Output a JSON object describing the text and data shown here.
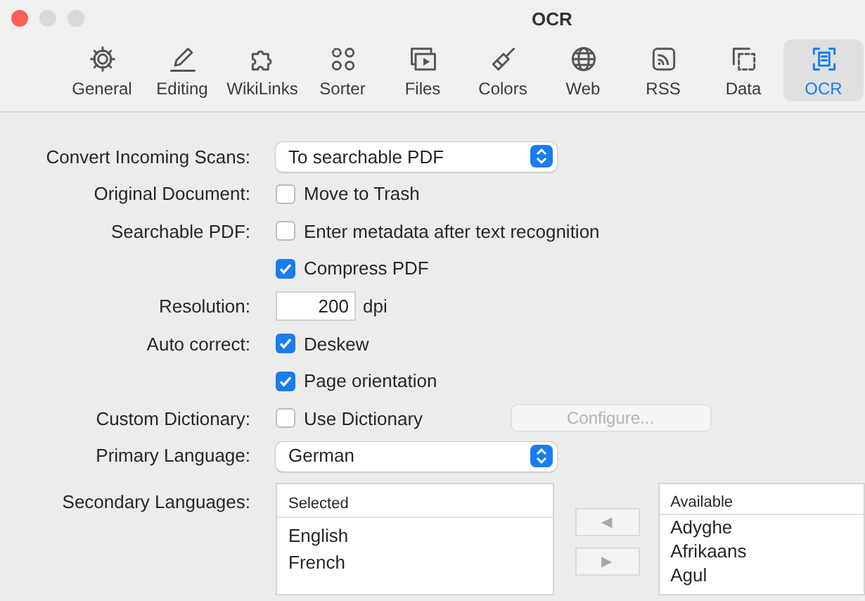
{
  "window": {
    "title": "OCR"
  },
  "toolbar": [
    {
      "label": "General",
      "selected": false
    },
    {
      "label": "Editing",
      "selected": false
    },
    {
      "label": "WikiLinks",
      "selected": false
    },
    {
      "label": "Sorter",
      "selected": false
    },
    {
      "label": "Files",
      "selected": false
    },
    {
      "label": "Colors",
      "selected": false
    },
    {
      "label": "Web",
      "selected": false
    },
    {
      "label": "RSS",
      "selected": false
    },
    {
      "label": "Data",
      "selected": false
    },
    {
      "label": "OCR",
      "selected": true
    }
  ],
  "rows": [
    {
      "label": "Convert Incoming Scans:",
      "controls": [
        {
          "kind": "popup",
          "value": "To searchable PDF"
        }
      ]
    },
    {
      "label": "Original Document:",
      "controls": [
        {
          "kind": "checkbox",
          "label": "Move to Trash",
          "checked": false
        }
      ]
    },
    {
      "label": "Searchable PDF:",
      "controls": [
        {
          "kind": "checkbox",
          "label": "Enter metadata after text recognition",
          "checked": false
        }
      ]
    },
    {
      "controls": [
        {
          "kind": "checkbox",
          "label": "Compress PDF",
          "checked": true
        }
      ]
    },
    {
      "label": "Resolution:",
      "controls": [
        {
          "kind": "number",
          "value": "200",
          "unit": "dpi"
        }
      ]
    },
    {
      "label": "Auto correct:",
      "controls": [
        {
          "kind": "checkbox",
          "label": "Deskew",
          "checked": true
        }
      ]
    },
    {
      "controls": [
        {
          "kind": "checkbox",
          "label": "Page orientation",
          "checked": true
        }
      ]
    },
    {
      "label": "Custom Dictionary:",
      "controls": [
        {
          "kind": "checkbox",
          "label": "Use Dictionary",
          "checked": false
        },
        {
          "kind": "button",
          "label": "Configure...",
          "disabled": true
        }
      ]
    },
    {
      "label": "Primary Language:",
      "controls": [
        {
          "kind": "popup",
          "value": "German"
        }
      ]
    }
  ],
  "secondary": {
    "label": "Secondary Languages:",
    "selected_list": {
      "header": "Selected",
      "items": [
        "English",
        "French"
      ]
    },
    "move_buttons": [
      "◀",
      "▶"
    ],
    "available_list": {
      "header": "Available",
      "items": [
        "Adyghe",
        "Afrikaans",
        "Agul"
      ]
    }
  }
}
